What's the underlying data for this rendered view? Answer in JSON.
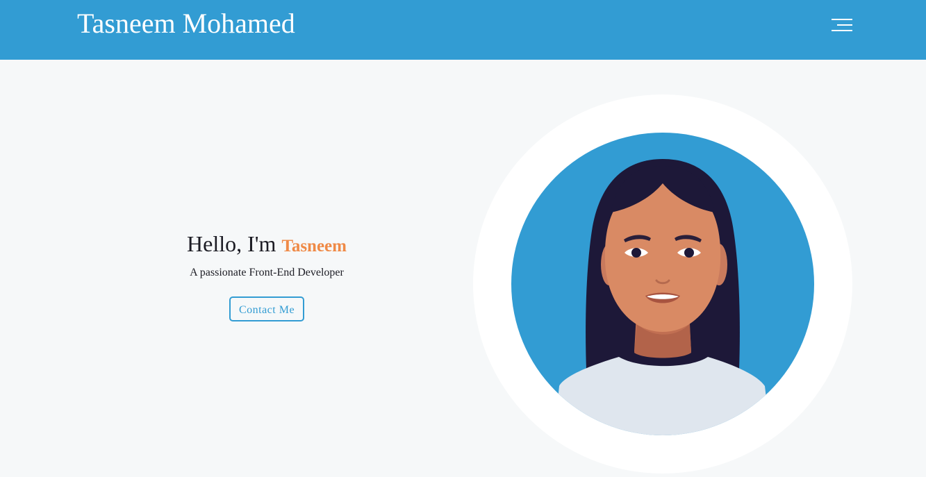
{
  "navbar": {
    "brand": "Tasneem Mohamed",
    "menu_icon": "hamburger-menu-icon",
    "background": "#329cd3"
  },
  "hero": {
    "greeting_prefix": "Hello, I'm",
    "greeting_name": "Tasneem",
    "tagline": "A passionate Front-End Developer",
    "cta_label": "Contact Me",
    "accent_color": "#ef8a47",
    "primary_color": "#329cd3",
    "avatar_icon": "woman-avatar-illustration"
  }
}
